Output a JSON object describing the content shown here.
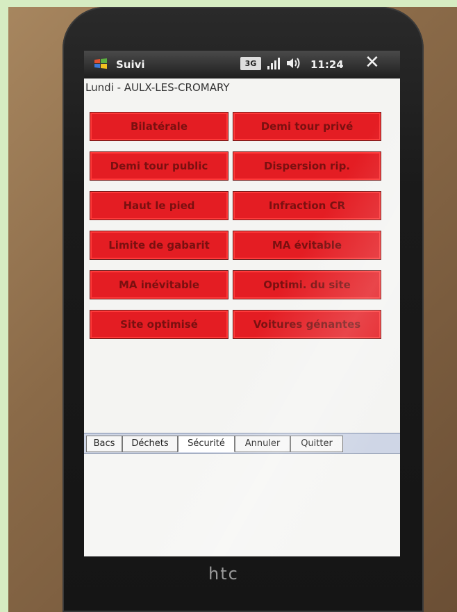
{
  "titlebar": {
    "app_title": "Suivi",
    "network": "3G",
    "clock": "11:24",
    "close_glyph": "✕"
  },
  "location": "Lundi - AULX-LES-CROMARY",
  "buttons": [
    "Bilatérale",
    "Demi tour privé",
    "Demi tour public",
    "Dispersion rip.",
    "Haut le pied",
    "Infraction CR",
    "Limite de gabarit",
    "MA évitable",
    "MA inévitable",
    "Optimi. du site",
    "Site optimisé",
    "Voitures génantes"
  ],
  "tabs": [
    "Bacs",
    "Déchets",
    "Sécurité",
    "Annuler",
    "Quitter"
  ],
  "active_tab": "Sécurité",
  "device_brand": "htc",
  "colors": {
    "button_red": "#e41d23",
    "button_text": "#7a1010",
    "tab_bar": "#cfd6e6"
  }
}
